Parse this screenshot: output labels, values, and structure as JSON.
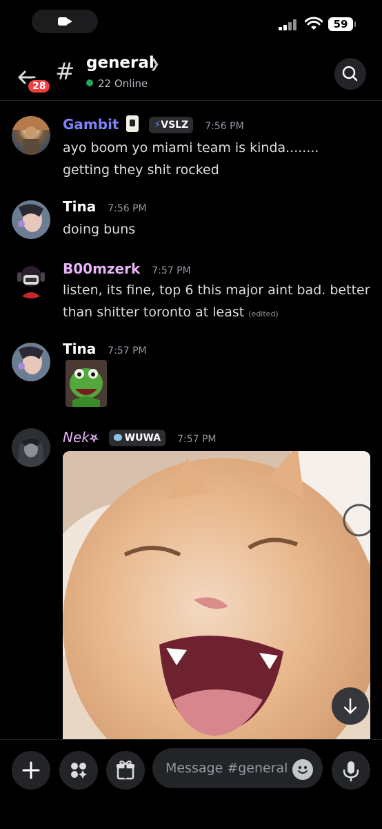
{
  "status_bar": {
    "battery": "59"
  },
  "header": {
    "unread_badge": "28",
    "channel_hash": "#",
    "channel_name": "general",
    "online_text": "22 Online"
  },
  "messages": [
    {
      "author": "Gambit",
      "author_color": "#7c83f5",
      "tag": "VSLZ",
      "tag_icon": "lightning-icon",
      "time": "7:56 PM",
      "lines": [
        "ayo boom yo miami team is kinda........",
        "getting they shit rocked"
      ]
    },
    {
      "author": "Tina",
      "author_color": "#ffffff",
      "time": "7:56 PM",
      "lines": [
        "doing buns"
      ]
    },
    {
      "author": "B00mzerk",
      "author_color": "#e8b3f7",
      "time": "7:57 PM",
      "lines": [
        "listen, its fine, top 6 this major aint bad. better",
        "than shitter toronto at least"
      ],
      "edited": "(edited)"
    },
    {
      "author": "Tina",
      "author_color": "#ffffff",
      "time": "7:57 PM",
      "attachment": "kermit-image"
    },
    {
      "author": "Nek",
      "author_color": "#e8b3f7",
      "author_suffix_icon": "pentagram-icon",
      "tag": "WUWA",
      "tag_icon": "fox-icon",
      "time": "7:57 PM",
      "attachment": "cat-image"
    }
  ],
  "composer": {
    "placeholder": "Message #general"
  }
}
